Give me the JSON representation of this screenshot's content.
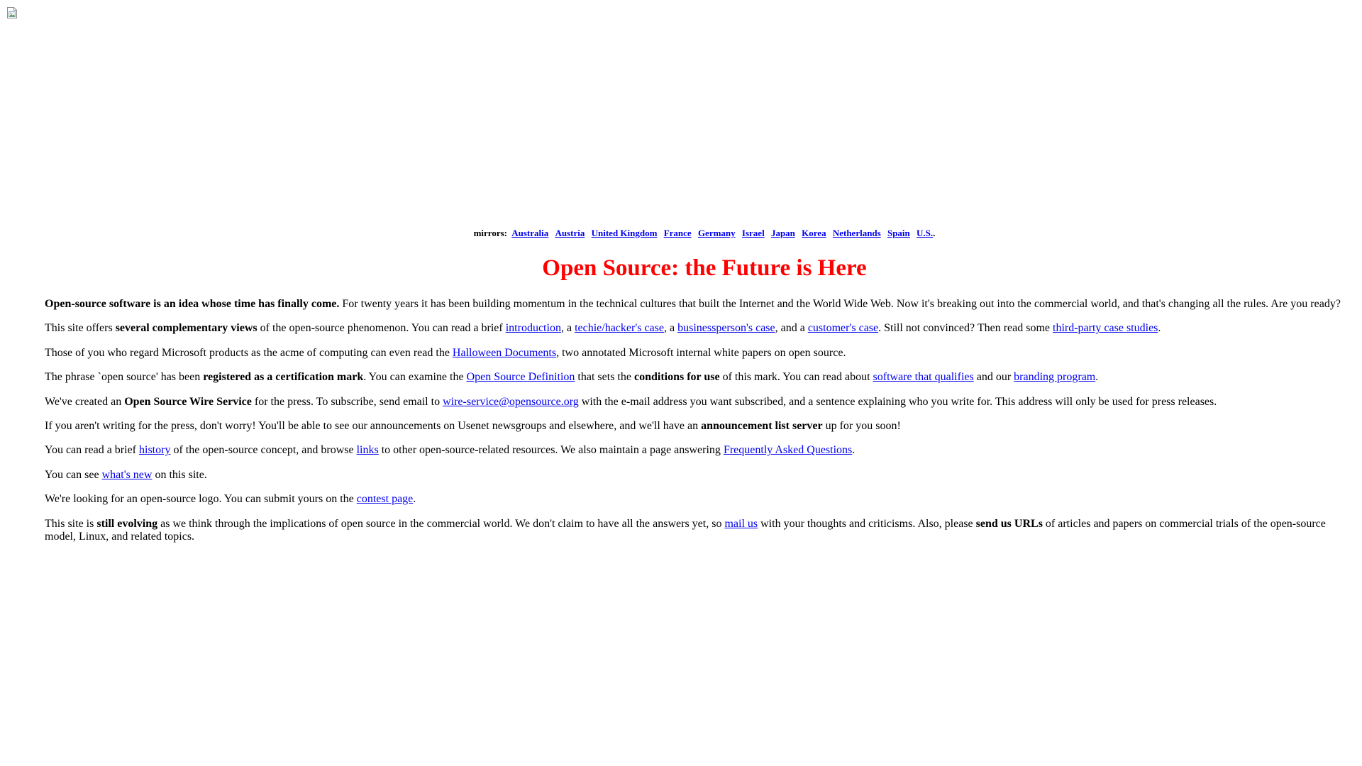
{
  "page": {
    "mirrors": {
      "label": "mirrors:",
      "links": [
        "Australia",
        "Austria",
        "United Kingdom",
        "France",
        "Germany",
        "Israel",
        "Japan",
        "Korea",
        "Netherlands",
        "Spain",
        "U.S."
      ],
      "end": "."
    },
    "title": "Open Source: the Future is Here",
    "p1": {
      "b1": "Open-source software is an idea whose time has finally come.",
      "t1": " For twenty years it has been building momentum in the technical cultures that built the Internet and the World Wide Web. Now it's breaking out into the commercial world, and that's changing all the rules. Are you ready?"
    },
    "p2": {
      "t1": "This site offers ",
      "b1": "several complementary views",
      "t2": " of the open-source phenomenon. You can read a brief ",
      "l1": "introduction",
      "t3": ", a ",
      "l2": "techie/hacker's case",
      "t4": ", a ",
      "l3": "businessperson's case",
      "t5": ", and a ",
      "l4": "customer's case",
      "t6": ". Still not convinced? Then read some ",
      "l5": "third-party case studies",
      "t7": "."
    },
    "p3": {
      "t1": "Those of you who regard Microsoft products as the acme of computing can even read the ",
      "l1": "Halloween Documents",
      "t2": ", two annotated Microsoft internal white papers on open source."
    },
    "p4": {
      "t1": "The phrase `open source' has been ",
      "b1": "registered as a certification mark",
      "t2": ". You can examine the ",
      "l1": "Open Source Definition",
      "t3": " that sets the ",
      "b2": "conditions for use",
      "t4": " of this mark. You can read about ",
      "l2": "software that qualifies",
      "t5": " and our ",
      "l3": "branding program",
      "t6": "."
    },
    "p5": {
      "t1": "We've created an ",
      "b1": "Open Source Wire Service",
      "t2": " for the press. To subscribe, send email to ",
      "l1": "wire-service@opensource.org",
      "t3": " with the e-mail address you want subscribed, and a sentence explaining who you write for. This address will only be used for press releases."
    },
    "p6": {
      "t1": "If you aren't writing for the press, don't worry! You'll be able to see our announcements on Usenet newsgroups and elsewhere, and we'll have an ",
      "b1": "announcement list server",
      "t2": " up for you soon!"
    },
    "p7": {
      "t1": "You can read a brief ",
      "l1": "history",
      "t2": " of the open-source concept, and browse ",
      "l2": "links",
      "t3": " to other open-source-related resources. We also maintain a page answering ",
      "l3": "Frequently Asked Questions",
      "t4": "."
    },
    "p8": {
      "t1": "You can see ",
      "l1": "what's new",
      "t2": " on this site."
    },
    "p9": {
      "t1": "We're looking for an open-source logo. You can submit yours on the ",
      "l1": "contest page",
      "t2": "."
    },
    "p10": {
      "t1": "This site is ",
      "b1": "still evolving",
      "t2": " as we think through the implications of open source in the commercial world. We don't claim to have all the answers yet, so ",
      "l1": "mail us",
      "t3": " with your thoughts and criticisms. Also, please ",
      "b2": "send us URLs",
      "t4": " of articles and papers on commercial trials of the open-source model, Linux, and related topics."
    }
  },
  "icons": {
    "broken_image": "broken-image-icon"
  },
  "colors": {
    "title": "#ff0000",
    "link": "#0000ee",
    "text": "#000000",
    "background": "#ffffff"
  }
}
